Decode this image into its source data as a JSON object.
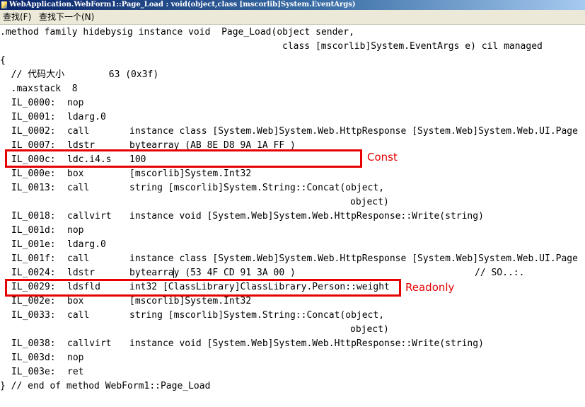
{
  "window": {
    "title": "WebApplication.WebForm1::Page_Load : void(object,class [mscorlib]System.EventArgs)"
  },
  "menu": [
    {
      "label": "查找(F)"
    },
    {
      "label": "查找下一个(N)"
    }
  ],
  "code": {
    "header": [
      ".method family hidebysig instance void  Page_Load(object sender,",
      "class [mscorlib]System.EventArgs e) cil managed",
      "{"
    ],
    "comment": "  // 代码大小        63 (0x3f)",
    "maxstack": "  .maxstack  8",
    "instructions": [
      {
        "label": "IL_0000:",
        "op": "nop",
        "arg": ""
      },
      {
        "label": "IL_0001:",
        "op": "ldarg.0",
        "arg": ""
      },
      {
        "label": "IL_0002:",
        "op": "call",
        "arg": "instance class [System.Web]System.Web.HttpResponse [System.Web]System.Web.UI.Page"
      },
      {
        "label": "IL_0007:",
        "op": "ldstr",
        "arg": "bytearray (AB 8E D8 9A 1A FF )"
      },
      {
        "label": "IL_000c:",
        "op": "ldc.i4.s",
        "arg": "100"
      },
      {
        "label": "IL_000e:",
        "op": "box",
        "arg": "[mscorlib]System.Int32"
      },
      {
        "label": "IL_0013:",
        "op": "call",
        "arg": "string [mscorlib]System.String::Concat(object,"
      },
      {
        "label": "",
        "op": "",
        "arg": "object)",
        "continuation": true
      },
      {
        "label": "IL_0018:",
        "op": "callvirt",
        "arg": "instance void [System.Web]System.Web.HttpResponse::Write(string)"
      },
      {
        "label": "IL_001d:",
        "op": "nop",
        "arg": ""
      },
      {
        "label": "IL_001e:",
        "op": "ldarg.0",
        "arg": ""
      },
      {
        "label": "IL_001f:",
        "op": "call",
        "arg": "instance class [System.Web]System.Web.HttpResponse [System.Web]System.Web.UI.Page"
      },
      {
        "label": "IL_0024:",
        "op": "ldstr",
        "arg": "bytearray (53 4F CD 91 3A 00 )",
        "trailing": "// SO..:."
      },
      {
        "label": "IL_0029:",
        "op": "ldsfld",
        "arg": "int32 [ClassLibrary]ClassLibrary.Person::weight"
      },
      {
        "label": "IL_002e:",
        "op": "box",
        "arg": "[mscorlib]System.Int32"
      },
      {
        "label": "IL_0033:",
        "op": "call",
        "arg": "string [mscorlib]System.String::Concat(object,"
      },
      {
        "label": "",
        "op": "",
        "arg": "object)",
        "continuation": true
      },
      {
        "label": "IL_0038:",
        "op": "callvirt",
        "arg": "instance void [System.Web]System.Web.HttpResponse::Write(string)"
      },
      {
        "label": "IL_003d:",
        "op": "nop",
        "arg": ""
      },
      {
        "label": "IL_003e:",
        "op": "ret",
        "arg": ""
      }
    ],
    "footer": "} // end of method WebForm1::Page_Load"
  },
  "annotations": [
    {
      "text": "Const",
      "color": "#e60000"
    },
    {
      "text": "Readonly",
      "color": "#e60000"
    }
  ],
  "colors": {
    "highlight": "#e60000",
    "menubar": "#ece9d8",
    "titlebar_start": "#0a246a",
    "titlebar_end": "#a6caf0"
  }
}
